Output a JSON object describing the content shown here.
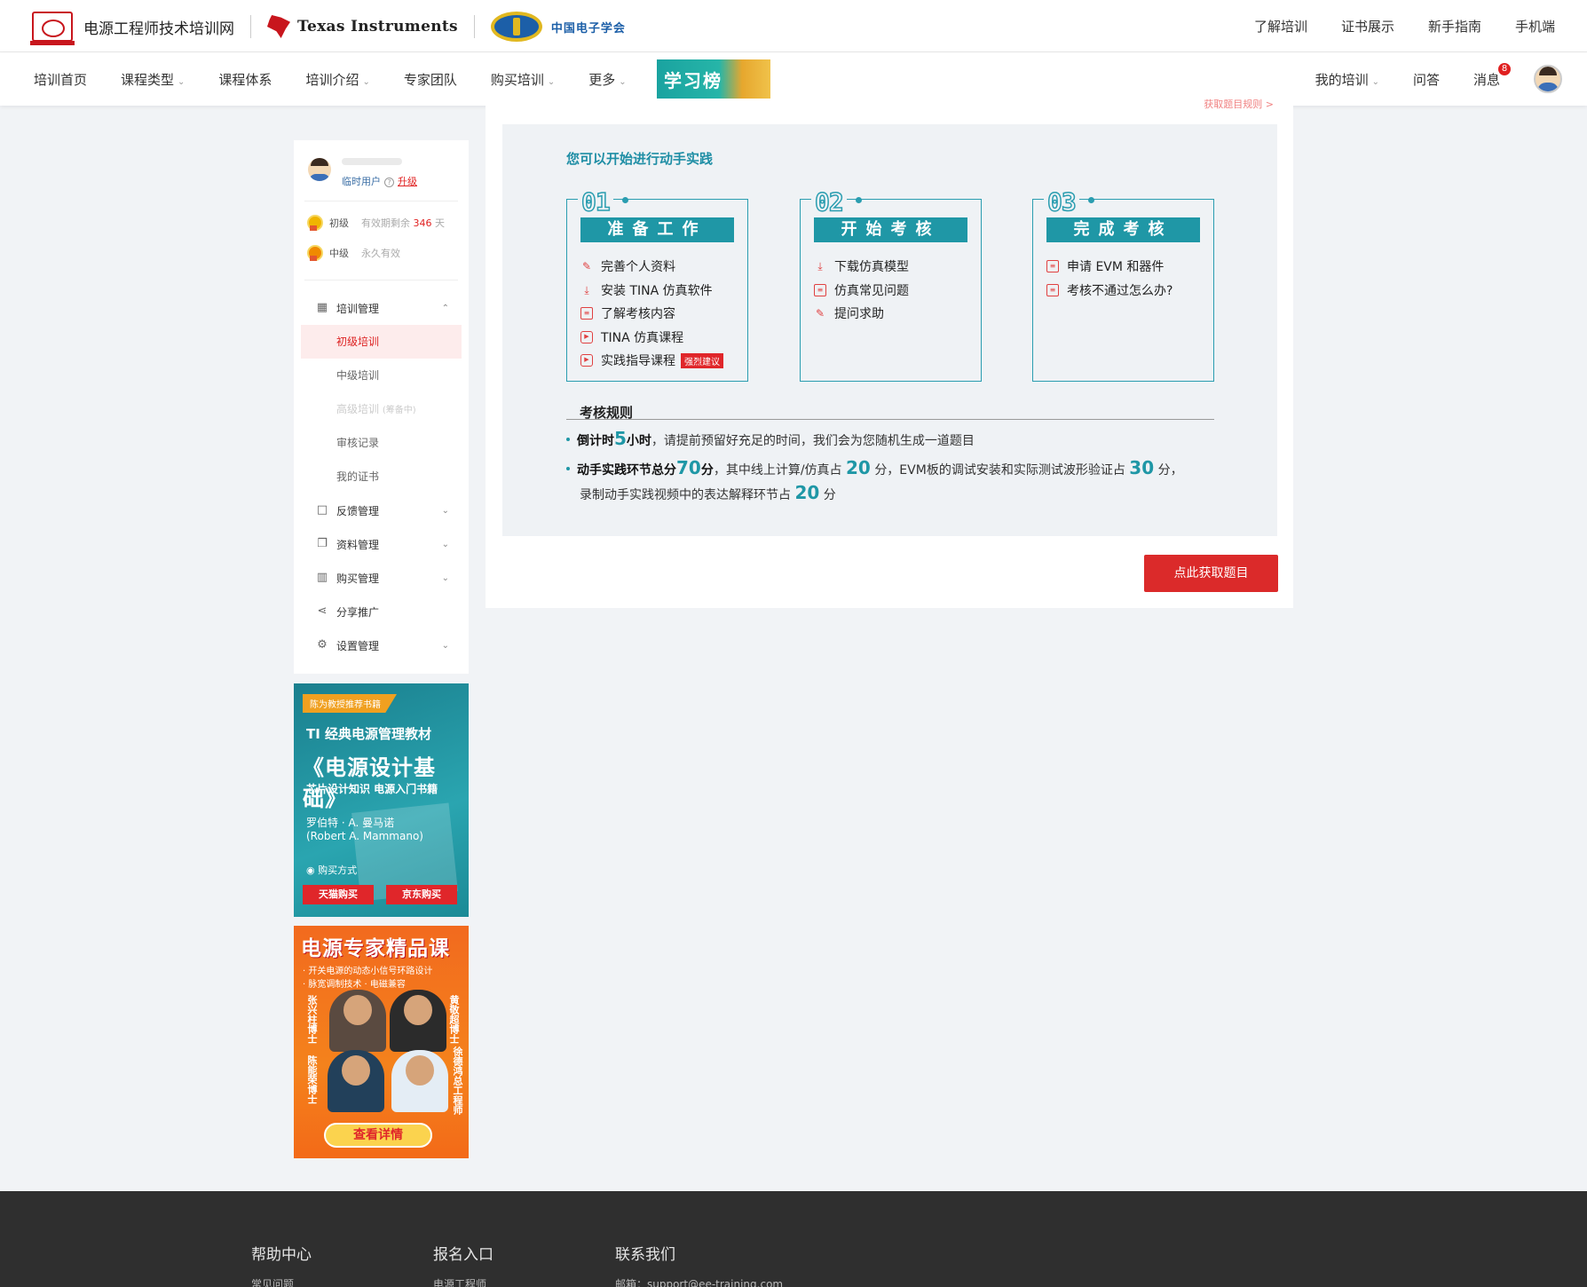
{
  "header": {
    "site_name": "电源工程师技术培训网",
    "ti_name": "Texas Instruments",
    "cie_name": "中国电子学会",
    "top_links": [
      "了解培训",
      "证书展示",
      "新手指南",
      "手机端"
    ]
  },
  "nav": {
    "items": [
      {
        "label": "培训首页",
        "caret": false
      },
      {
        "label": "课程类型",
        "caret": true
      },
      {
        "label": "课程体系",
        "caret": false
      },
      {
        "label": "培训介绍",
        "caret": true
      },
      {
        "label": "专家团队",
        "caret": false
      },
      {
        "label": "购买培训",
        "caret": true
      },
      {
        "label": "更多",
        "caret": true
      }
    ],
    "banner": "学习榜",
    "right": {
      "my_training": "我的培训",
      "qa": "问答",
      "messages": "消息",
      "message_count": "8"
    }
  },
  "sidebar": {
    "user_type": "临时用户",
    "upgrade": "升级",
    "levels": [
      {
        "name": "初级",
        "prefix": "有效期剩余",
        "days": "346",
        "suffix": "天"
      },
      {
        "name": "中级",
        "status": "永久有效"
      }
    ],
    "menu": {
      "training": "培训管理",
      "sub": [
        "初级培训",
        "中级培训",
        "高级培训",
        "审核记录",
        "我的证书"
      ],
      "sub_note": "(筹备中)",
      "feedback": "反馈管理",
      "materials": "资料管理",
      "purchase": "购买管理",
      "share": "分享推广",
      "settings": "设置管理"
    }
  },
  "ad_book": {
    "tag": "陈为教授推荐书籍",
    "line1": "TI 经典电源管理教材",
    "title": "《电源设计基础》",
    "subtitle": "芯片设计知识 电源入门书籍",
    "author_cn": "罗伯特 · A. 曼马诺",
    "author_en": "(Robert A. Mammano)",
    "buy_label": "购买方式",
    "btn_tmall": "天猫购买",
    "btn_jd": "京东购买"
  },
  "ad_course": {
    "title": "电源专家精品课",
    "lines": [
      "· 开关电源的动态小信号环路设计",
      "· 脉宽调制技术 · 电磁兼容"
    ],
    "names": [
      "张兴柱博士",
      "黄敬超博士",
      "陈能荣博士",
      "徐德鸿总工程师"
    ],
    "btn": "查看详情"
  },
  "main": {
    "cut_link": "获取题目规则 >",
    "section_title": "您可以开始进行动手实践",
    "steps": [
      {
        "num": "01",
        "title": "准备工作",
        "items": [
          {
            "icon": "edit-icon",
            "label": "完善个人资料"
          },
          {
            "icon": "download-icon",
            "label": "安装 TINA 仿真软件"
          },
          {
            "icon": "document-icon",
            "label": "了解考核内容"
          },
          {
            "icon": "play-icon",
            "label": "TINA 仿真课程"
          },
          {
            "icon": "play-icon",
            "label": "实践指导课程",
            "tag": "强烈建议"
          }
        ]
      },
      {
        "num": "02",
        "title": "开始考核",
        "items": [
          {
            "icon": "download-icon",
            "label": "下载仿真模型"
          },
          {
            "icon": "document-icon",
            "label": "仿真常见问题"
          },
          {
            "icon": "edit-icon",
            "label": "提问求助"
          }
        ]
      },
      {
        "num": "03",
        "title": "完成考核",
        "items": [
          {
            "icon": "document-icon",
            "label": "申请 EVM 和器件"
          },
          {
            "icon": "document-icon",
            "label": "考核不通过怎么办?"
          }
        ]
      }
    ],
    "rules_title": "考核规则",
    "rule1": {
      "b1": "倒计时",
      "num": "5",
      "b2": "小时",
      "text": "，请提前预留好充足的时间，我们会为您随机生成一道题目"
    },
    "rule2": {
      "b1": "动手实践环节总分",
      "n1": "70",
      "b2": "分",
      "t1": "，其中线上计算/仿真占",
      "n2": "20",
      "t2": "分，EVM板的调试安装和实际测试波形验证占",
      "n3": "30",
      "t3": "分，",
      "t4": "录制动手实践视频中的表达解释环节占",
      "n4": "20",
      "t5": "分"
    },
    "get_button": "点此获取题目"
  },
  "footer": {
    "cols": [
      "帮助中心",
      "报名入口",
      "联系我们"
    ],
    "subs": [
      "常见问题",
      "电源工程师",
      "邮箱：support@ee-training.com"
    ]
  },
  "colors": {
    "accent": "#1f97a6",
    "brand_red": "#db2a2a",
    "footer_bg": "#2f2f2f"
  }
}
